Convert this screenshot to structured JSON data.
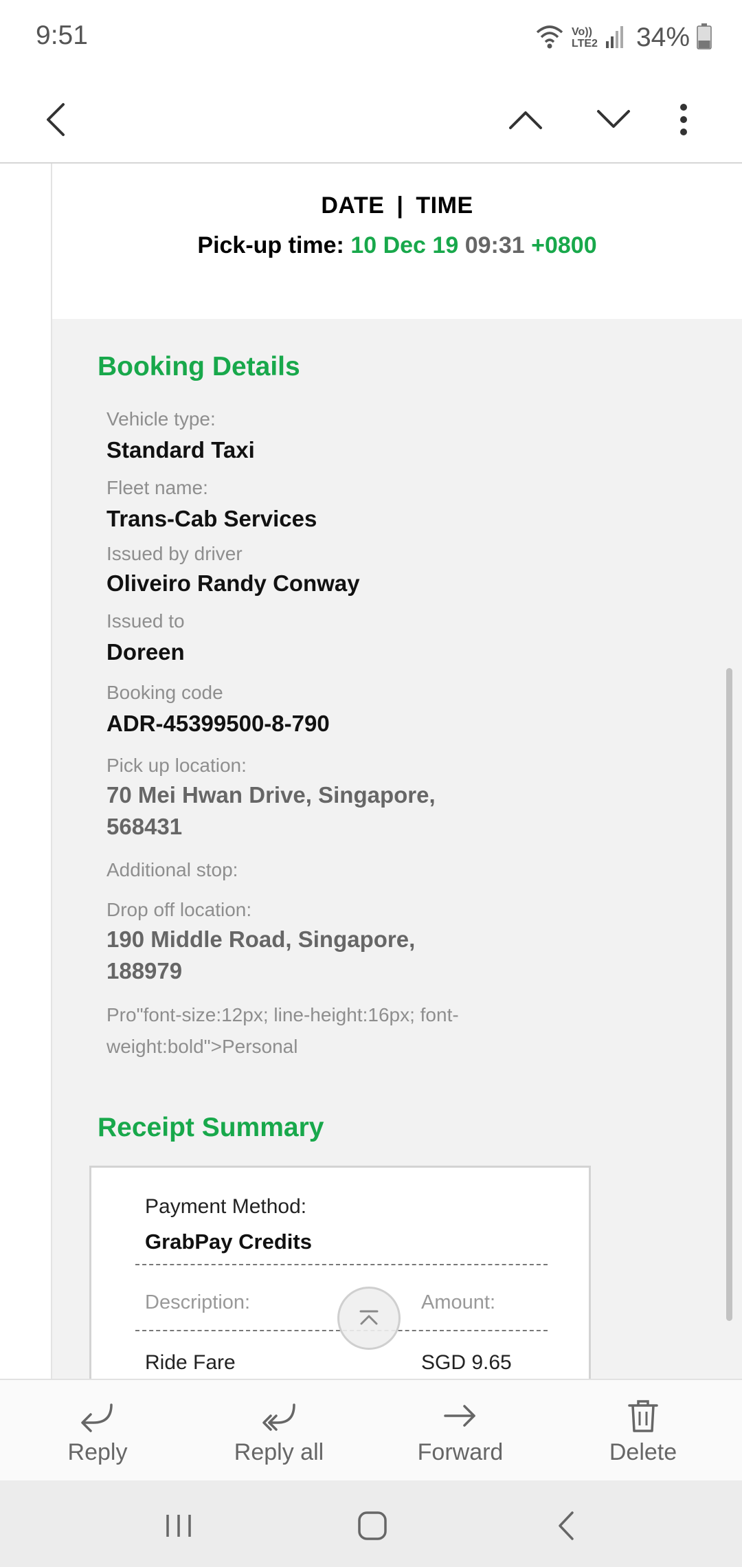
{
  "status_bar": {
    "time": "9:51",
    "network_label_top": "Vo))",
    "network_label_bottom": "LTE2",
    "battery_percent": "34%"
  },
  "app_bar": {
    "back_icon": "chevron-left-icon",
    "prev_icon": "chevron-up-icon",
    "next_icon": "chevron-down-icon",
    "more_icon": "more-vertical-icon"
  },
  "email": {
    "date_label": "DATE",
    "separator": "|",
    "time_label": "TIME",
    "pickup_label": "Pick-up time:",
    "pickup_date": "10 Dec 19",
    "pickup_time": "09:31",
    "pickup_tz": "+0800",
    "booking_details_title": "Booking Details",
    "fields": [
      {
        "label": "Vehicle type:",
        "value": "Standard Taxi"
      },
      {
        "label": "Fleet name:",
        "value": "Trans-Cab Services"
      },
      {
        "label": "Issued by driver",
        "value": "Oliveiro Randy Conway"
      },
      {
        "label": "Issued to",
        "value": "Doreen"
      },
      {
        "label": "Booking code",
        "value": "ADR-45399500-8-790"
      }
    ],
    "pickup_location_label": "Pick up location:",
    "pickup_location": "70 Mei Hwan Drive, Singapore, 568431",
    "additional_stop_label": "Additional stop:",
    "dropoff_location_label": "Drop off location:",
    "dropoff_location": "190 Middle Road, Singapore, 188979",
    "profile_text": "Pro\"font-size:12px; line-height:16px; font-weight:bold\">Personal",
    "receipt_title": "Receipt Summary",
    "receipt": {
      "payment_method_label": "Payment Method:",
      "payment_method_value": "GrabPay Credits",
      "description_label": "Description:",
      "amount_label": "Amount:",
      "rows": [
        {
          "description": "Ride Fare",
          "amount": "SGD 9.65"
        }
      ]
    }
  },
  "scroll_top_icon": "scroll-to-top-icon",
  "actions": [
    {
      "label": "Reply",
      "icon": "reply-icon"
    },
    {
      "label": "Reply all",
      "icon": "reply-all-icon"
    },
    {
      "label": "Forward",
      "icon": "forward-icon"
    },
    {
      "label": "Delete",
      "icon": "trash-icon"
    }
  ],
  "nav_bar": {
    "recents_icon": "recents-icon",
    "home_icon": "home-icon",
    "back_icon": "back-icon"
  },
  "colors": {
    "accent_green": "#18a84b",
    "muted_text": "#666666",
    "label_gray": "#8e8e8e"
  }
}
